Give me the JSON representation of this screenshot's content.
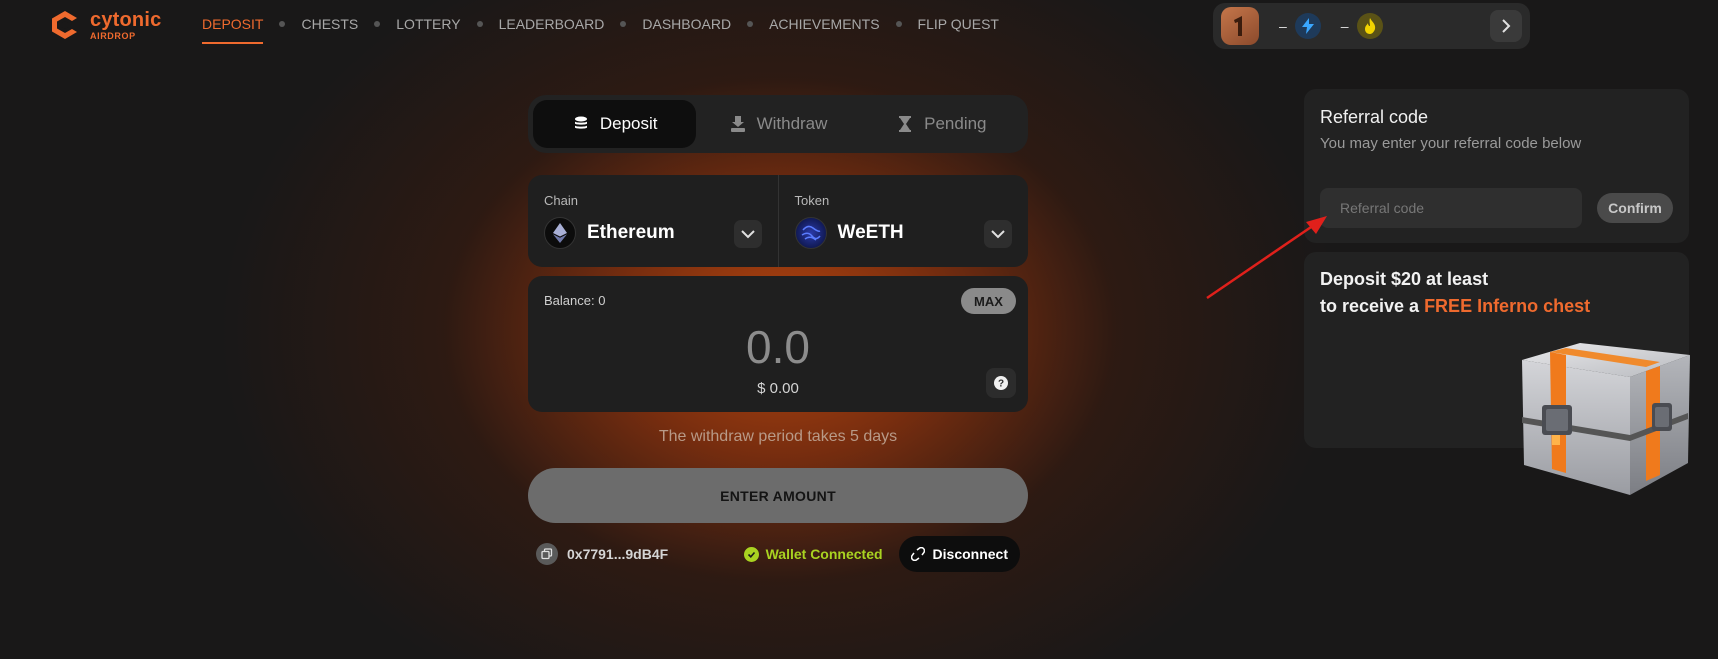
{
  "brand": {
    "name": "cytonic",
    "sub": "AIRDROP"
  },
  "nav": {
    "items": [
      {
        "label": "DEPOSIT",
        "active": true
      },
      {
        "label": "CHESTS",
        "active": false
      },
      {
        "label": "LOTTERY",
        "active": false
      },
      {
        "label": "LEADERBOARD",
        "active": false
      },
      {
        "label": "DASHBOARD",
        "active": false
      },
      {
        "label": "ACHIEVEMENTS",
        "active": false
      },
      {
        "label": "FLIP QUEST",
        "active": false
      }
    ]
  },
  "status": {
    "energy": "–",
    "fire": "–"
  },
  "tabs": [
    {
      "label": "Deposit",
      "icon": "coins-icon",
      "active": true
    },
    {
      "label": "Withdraw",
      "icon": "withdraw-icon",
      "active": false
    },
    {
      "label": "Pending",
      "icon": "hourglass-icon",
      "active": false
    }
  ],
  "chain": {
    "label": "Chain",
    "value": "Ethereum",
    "icon": "ethereum-icon"
  },
  "token": {
    "label": "Token",
    "value": "WeETH",
    "icon": "weeth-icon"
  },
  "amount": {
    "balance": "Balance: 0",
    "max_label": "MAX",
    "value": "0.0",
    "usd": "$ 0.00"
  },
  "notice": "The withdraw period takes 5 days",
  "submit_label": "ENTER AMOUNT",
  "wallet": {
    "address": "0x7791...9dB4F",
    "status": "Wallet Connected",
    "disconnect_label": "Disconnect"
  },
  "referral": {
    "title": "Referral code",
    "subtitle": "You may enter your referral code below",
    "placeholder": "Referral code",
    "confirm_label": "Confirm"
  },
  "promo": {
    "line1": "Deposit $20 at least",
    "line2_prefix": "to receive a ",
    "line2_accent": "FREE Inferno chest"
  },
  "colors": {
    "accent": "#ef6a2e",
    "connected": "#a9d321",
    "background": "#191818",
    "arrow": "#e0201b"
  }
}
